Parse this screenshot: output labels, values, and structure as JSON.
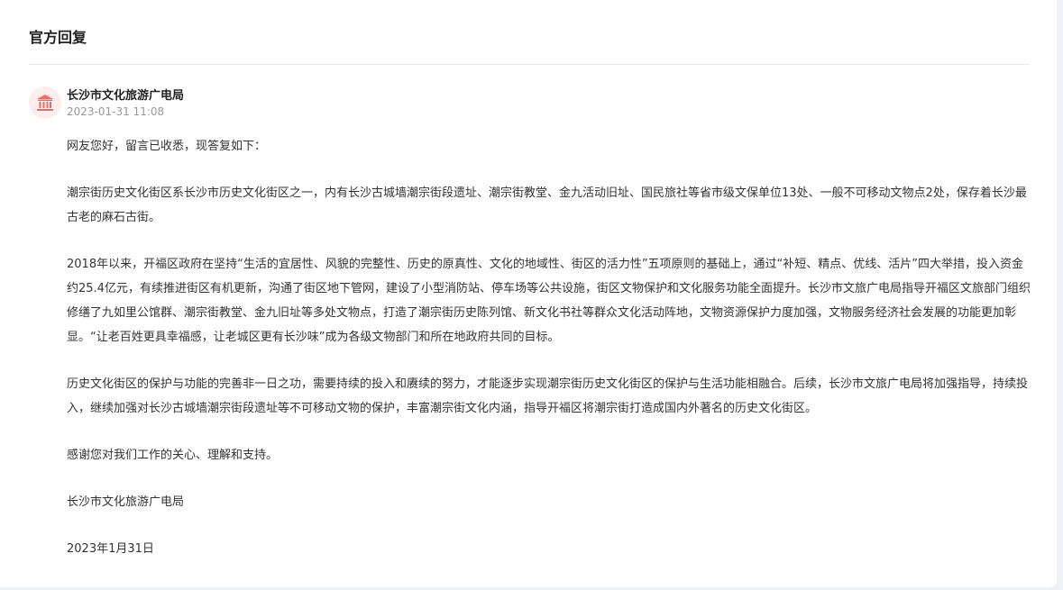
{
  "section": {
    "title": "官方回复"
  },
  "reply": {
    "org": "长沙市文化旅游广电局",
    "time": "2023-01-31 11:08",
    "avatar_icon": "government-building-icon",
    "accent_color": "#e07070",
    "paragraphs": [
      "网友您好，留言已收悉，现答复如下：",
      "潮宗街历史文化街区系长沙市历史文化街区之一，内有长沙古城墙潮宗街段遗址、潮宗街教堂、金九活动旧址、国民旅社等省市级文保单位13处、一般不可移动文物点2处，保存着长沙最古老的麻石古街。",
      "2018年以来，开福区政府在坚持“生活的宜居性、风貌的完整性、历史的原真性、文化的地域性、街区的活力性”五项原则的基础上，通过“补短、精点、优线、活片”四大举措，投入资金约25.4亿元，有续推进街区有机更新，沟通了街区地下管网，建设了小型消防站、停车场等公共设施，街区文物保护和文化服务功能全面提升。长沙市文旅广电局指导开福区文旅部门组织修缮了九如里公馆群、潮宗街教堂、金九旧址等多处文物点，打造了潮宗街历史陈列馆、新文化书社等群众文化活动阵地，文物资源保护力度加强，文物服务经济社会发展的功能更加彰显。“让老百姓更具幸福感，让老城区更有长沙味”成为各级文物部门和所在地政府共同的目标。",
      "历史文化街区的保护与功能的完善非一日之功，需要持续的投入和赓续的努力，才能逐步实现潮宗街历史文化街区的保护与生活功能相融合。后续，长沙市文旅广电局将加强指导，持续投入，继续加强对长沙古城墙潮宗街段遗址等不可移动文物的保护，丰富潮宗街文化内涵，指导开福区将潮宗街打造成国内外著名的历史文化街区。",
      "感谢您对我们工作的关心、理解和支持。",
      "长沙市文化旅游广电局",
      "2023年1月31日"
    ]
  }
}
